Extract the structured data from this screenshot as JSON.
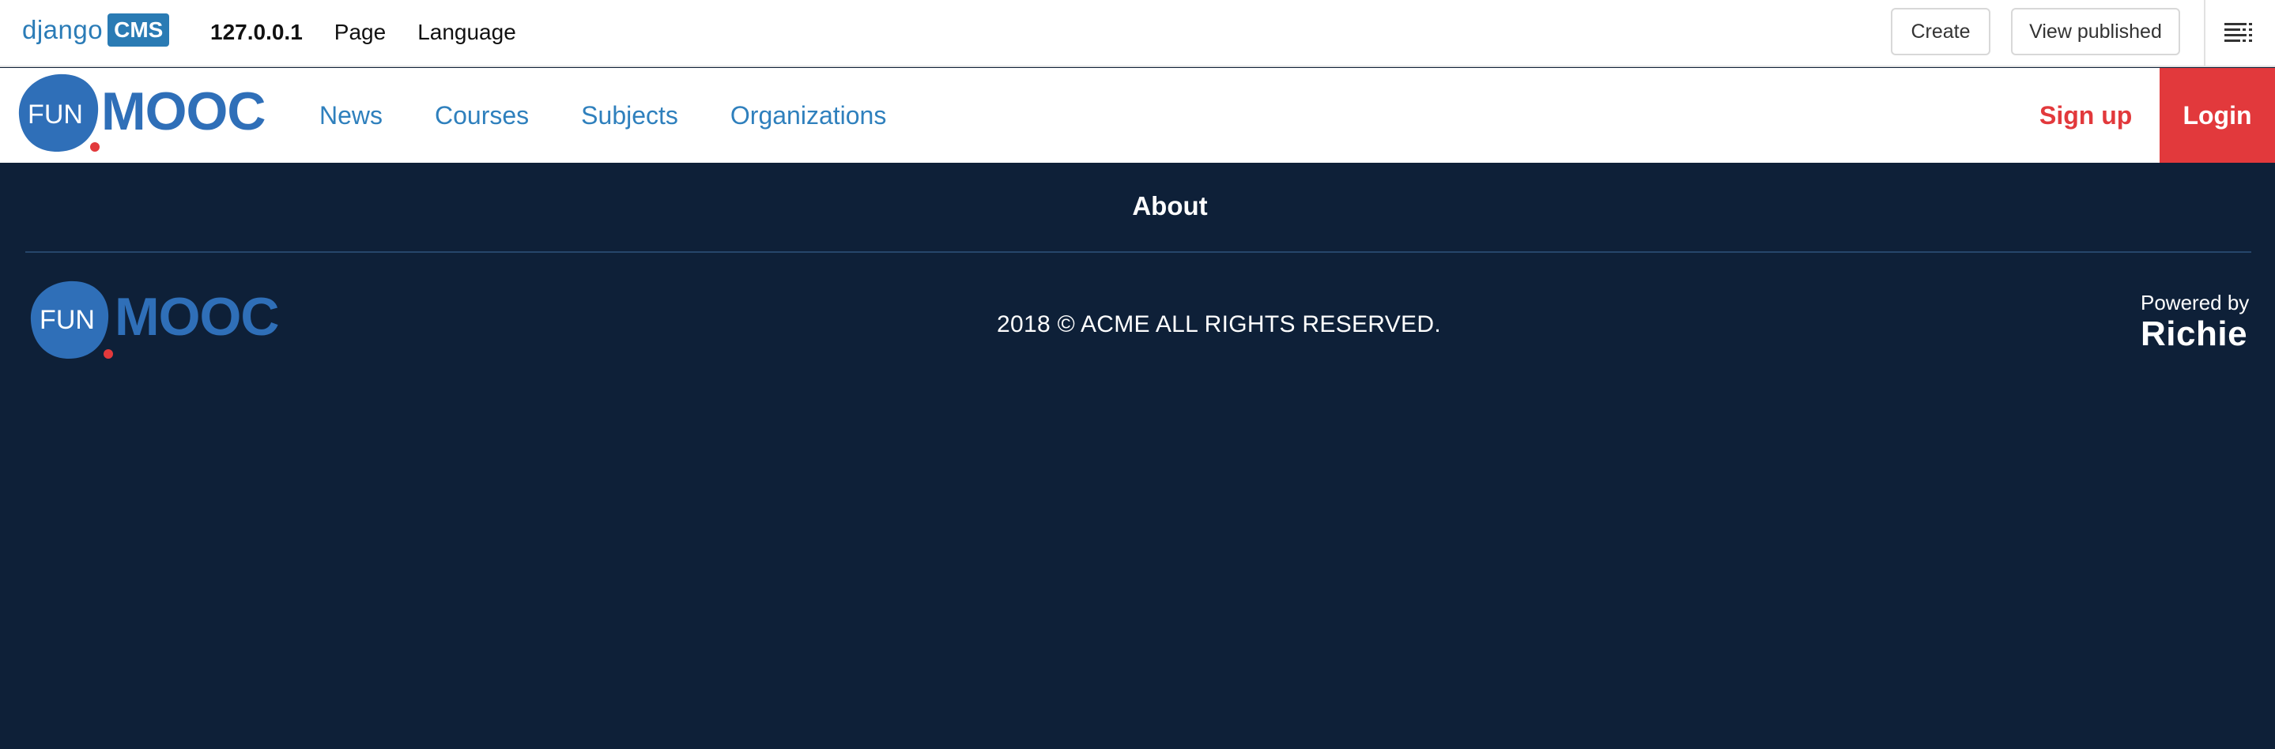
{
  "cms_toolbar": {
    "logo_text": "django",
    "logo_badge": "CMS",
    "host": "127.0.0.1",
    "menu": [
      "Page",
      "Language"
    ],
    "create_label": "Create",
    "view_published_label": "View published",
    "menu_icon": "hamburger-menu-icon"
  },
  "header": {
    "logo_left": "FUN",
    "logo_right": "MOOC",
    "nav": [
      "News",
      "Courses",
      "Subjects",
      "Organizations"
    ],
    "signup_label": "Sign up",
    "login_label": "Login"
  },
  "footer": {
    "about_label": "About",
    "logo_left": "FUN",
    "logo_right": "MOOC",
    "copyright": "2018 © ACME ALL RIGHTS RESERVED.",
    "powered_by": "Powered by",
    "powered_brand": "Richie"
  },
  "colors": {
    "brand_blue": "#2f80bd",
    "cms_blue": "#2a7bb4",
    "accent_red": "#e2393c",
    "footer_bg": "#0e2038"
  }
}
